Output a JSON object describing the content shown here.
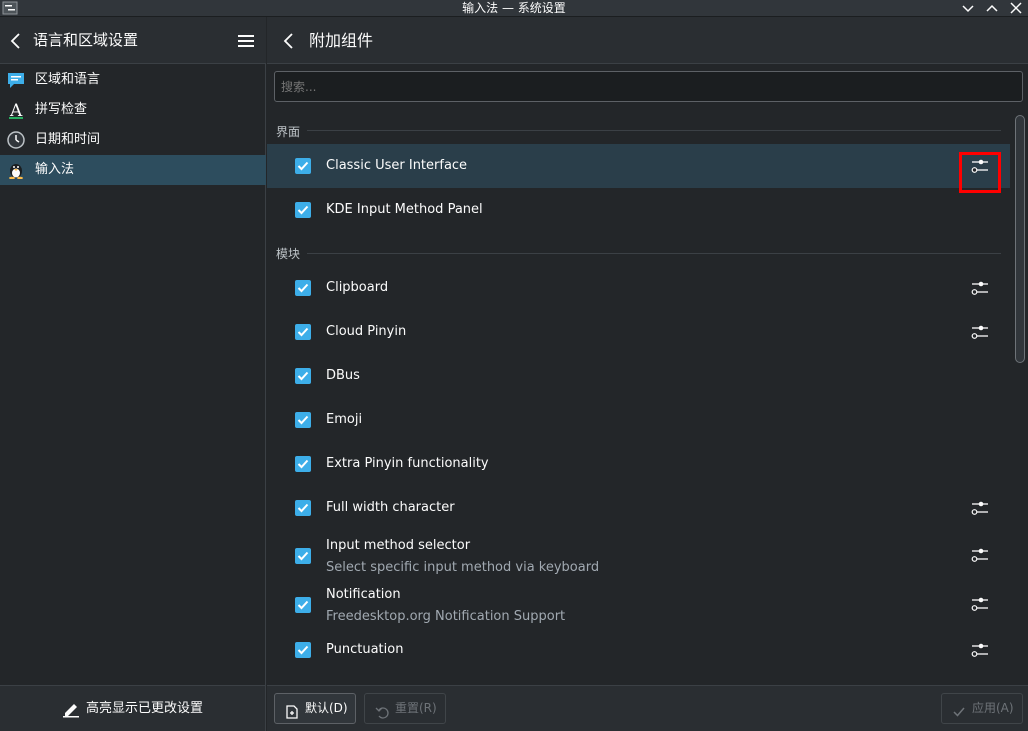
{
  "window": {
    "title": "输入法 — 系统设置"
  },
  "sidebar": {
    "title": "语言和区域设置",
    "items": [
      {
        "label": "区域和语言",
        "icon": "region-language-icon"
      },
      {
        "label": "拼写检查",
        "icon": "spellcheck-icon"
      },
      {
        "label": "日期和时间",
        "icon": "clock-icon"
      },
      {
        "label": "输入法",
        "icon": "input-method-icon",
        "active": true
      }
    ],
    "highlight_label": "高亮显示已更改设置"
  },
  "main": {
    "title": "附加组件",
    "search_placeholder": "搜索...",
    "sections": [
      {
        "title": "界面",
        "items": [
          {
            "label": "Classic User Interface",
            "checked": true,
            "configurable": true
          },
          {
            "label": "KDE Input Method Panel",
            "checked": true,
            "configurable": false
          }
        ]
      },
      {
        "title": "模块",
        "items": [
          {
            "label": "Clipboard",
            "checked": true,
            "configurable": true
          },
          {
            "label": "Cloud Pinyin",
            "checked": true,
            "configurable": true
          },
          {
            "label": "DBus",
            "checked": true,
            "configurable": false
          },
          {
            "label": "Emoji",
            "checked": true,
            "configurable": false
          },
          {
            "label": "Extra Pinyin functionality",
            "checked": true,
            "configurable": false
          },
          {
            "label": "Full width character",
            "checked": true,
            "configurable": true
          },
          {
            "label": "Input method selector",
            "description": "Select specific input method via keyboard",
            "checked": true,
            "configurable": true
          },
          {
            "label": "Notification",
            "description": "Freedesktop.org Notification Support",
            "checked": true,
            "configurable": true
          },
          {
            "label": "Punctuation",
            "checked": true,
            "configurable": true
          }
        ]
      }
    ]
  },
  "footer": {
    "defaults_label": "默认(D)",
    "reset_label": "重置(R)",
    "apply_label": "应用(A)"
  },
  "colors": {
    "accent": "#3daee9",
    "highlight_box": "#ff0000",
    "active_row": "#2a3e4a"
  }
}
